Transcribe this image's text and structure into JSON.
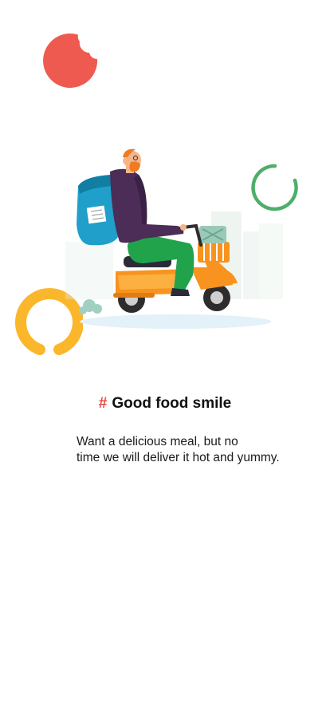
{
  "onboarding": {
    "title_prefix": "#",
    "title": "Good food smile",
    "description_lines": [
      "Want a delicious meal, but no",
      "time we will deliver it hot and yummy."
    ]
  },
  "colors": {
    "accent_red": "#ee5a4f",
    "accent_green": "#4caf6a",
    "accent_yellow": "#fbb72c",
    "scooter_orange": "#f7931e",
    "jacket_purple": "#4b2d57",
    "backpack_blue": "#1f9fc9"
  },
  "illustration": {
    "icon": "delivery-scooter-illustration"
  }
}
